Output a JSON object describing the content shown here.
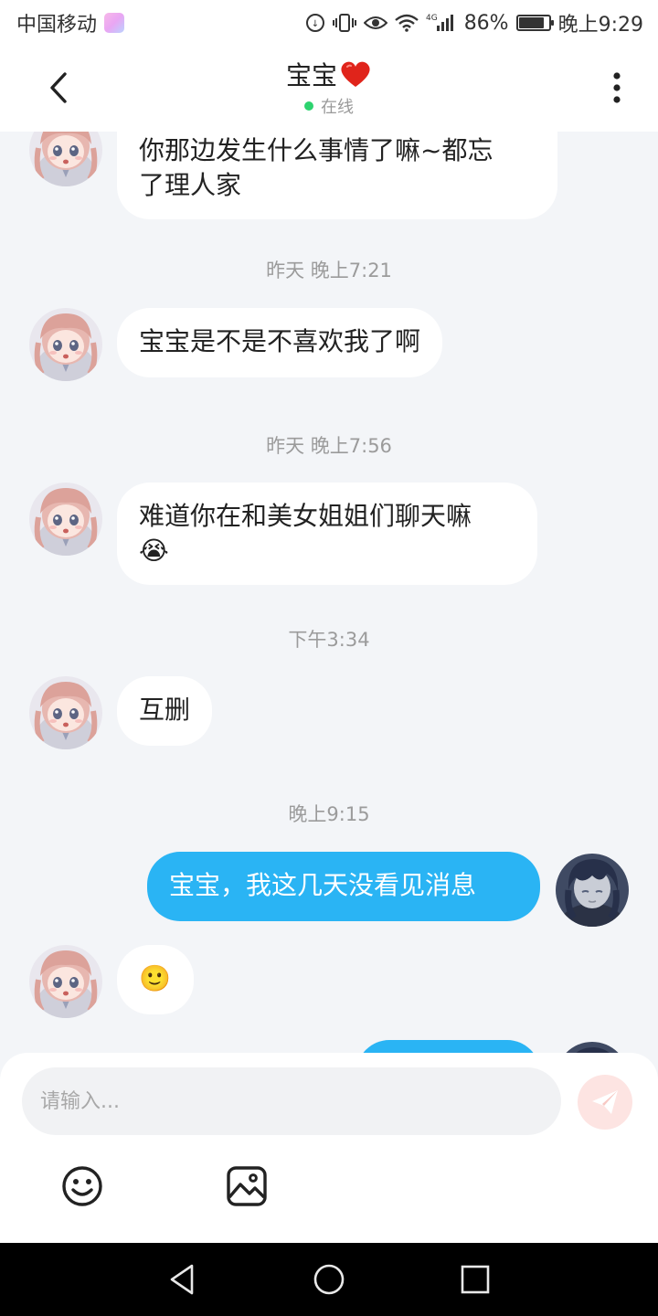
{
  "status_bar": {
    "carrier": "中国移动",
    "network": "4G",
    "battery": "86%",
    "battery_level": 0.86,
    "time": "晚上9:29"
  },
  "header": {
    "title": "宝宝",
    "status": "在线"
  },
  "messages": [
    {
      "side": "left",
      "text_line1": "你那边发生什么事情了嘛~都忘",
      "text_line2": "了理人家"
    },
    {
      "type": "time",
      "text": "昨天 晚上7:21"
    },
    {
      "side": "left",
      "text": "宝宝是不是不喜欢我了啊"
    },
    {
      "type": "time",
      "text": "昨天 晚上7:56"
    },
    {
      "side": "left",
      "text_line1": "难道你在和美女姐姐们聊天嘛",
      "text_line2": "😭"
    },
    {
      "type": "time",
      "text": "下午3:34"
    },
    {
      "side": "left",
      "text": "互删"
    },
    {
      "type": "time",
      "text": "晚上9:15"
    },
    {
      "side": "right",
      "text": "宝宝，我这几天没看见消息"
    },
    {
      "side": "left",
      "text": "🙂"
    },
    {
      "side": "right",
      "text": ""
    }
  ],
  "input": {
    "placeholder": "请输入...",
    "value": ""
  },
  "colors": {
    "accent": "#2ab4f4",
    "background": "#f3f5f8",
    "online": "#2dd36f",
    "heart": "#e0241b",
    "send_disabled": "#fde4e2"
  },
  "icons": {
    "back": "chevron-left-icon",
    "more": "more-vertical-icon",
    "send": "paper-plane-icon",
    "emoji": "smiley-icon",
    "image": "image-icon",
    "nav_back": "triangle-back-icon",
    "nav_home": "circle-home-icon",
    "nav_recent": "square-recent-icon"
  }
}
